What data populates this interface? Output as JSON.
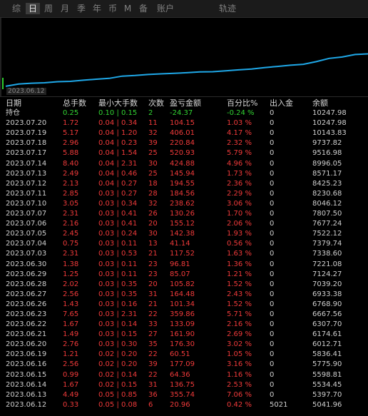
{
  "tabs": [
    "综",
    "日",
    "周",
    "月",
    "季",
    "年",
    "币",
    "M",
    "备",
    "账户",
    "轨迹"
  ],
  "active_tab": 1,
  "chart": {
    "date_label": "2023.06.12",
    "line_color": "#1fa8e8",
    "series": [
      5041.96,
      5397.7,
      5534.45,
      5598.81,
      5775.9,
      5836.41,
      6012.71,
      6174.61,
      6307.7,
      6667.56,
      6768.9,
      6933.38,
      7039.2,
      7124.27,
      7221.08,
      7338.6,
      7379.74,
      7522.12,
      7677.24,
      7807.5,
      8046.12,
      8230.68,
      8425.23,
      8571.17,
      8996.05,
      9516.98,
      9737.82,
      10143.83,
      10247.98
    ]
  },
  "colors": {
    "up": "#f03a3a",
    "down": "#32d232",
    "text": "#c8c8c8",
    "background": "#000000"
  },
  "table": {
    "headers": {
      "date": "日期",
      "total": "总手数",
      "minmax": "最小大手数",
      "count": "次数",
      "pl": "盈亏金额",
      "pct": "百分比%",
      "io": "出入金",
      "bal": "余额"
    },
    "holding": {
      "date": "持仓",
      "total": "0.25",
      "minmax": "0.10 | 0.15",
      "count": "2",
      "pl": "-24.37",
      "pct": "-0.24 %",
      "io": "0",
      "bal": "10247.98"
    },
    "rows": [
      {
        "date": "2023.07.20",
        "total": "1.72",
        "minmax": "0.04 | 0.34",
        "count": "11",
        "pl": "104.15",
        "pct": "1.03 %",
        "io": "0",
        "bal": "10247.98"
      },
      {
        "date": "2023.07.19",
        "total": "5.17",
        "minmax": "0.04 | 1.20",
        "count": "32",
        "pl": "406.01",
        "pct": "4.17 %",
        "io": "0",
        "bal": "10143.83"
      },
      {
        "date": "2023.07.18",
        "total": "2.96",
        "minmax": "0.04 | 0.23",
        "count": "39",
        "pl": "220.84",
        "pct": "2.32 %",
        "io": "0",
        "bal": "9737.82"
      },
      {
        "date": "2023.07.17",
        "total": "5.88",
        "minmax": "0.04 | 1.54",
        "count": "25",
        "pl": "520.93",
        "pct": "5.79 %",
        "io": "0",
        "bal": "9516.98"
      },
      {
        "date": "2023.07.14",
        "total": "8.40",
        "minmax": "0.04 | 2.31",
        "count": "30",
        "pl": "424.88",
        "pct": "4.96 %",
        "io": "0",
        "bal": "8996.05"
      },
      {
        "date": "2023.07.13",
        "total": "2.49",
        "minmax": "0.04 | 0.46",
        "count": "25",
        "pl": "145.94",
        "pct": "1.73 %",
        "io": "0",
        "bal": "8571.17"
      },
      {
        "date": "2023.07.12",
        "total": "2.13",
        "minmax": "0.04 | 0.27",
        "count": "18",
        "pl": "194.55",
        "pct": "2.36 %",
        "io": "0",
        "bal": "8425.23"
      },
      {
        "date": "2023.07.11",
        "total": "2.85",
        "minmax": "0.03 | 0.27",
        "count": "28",
        "pl": "184.56",
        "pct": "2.29 %",
        "io": "0",
        "bal": "8230.68"
      },
      {
        "date": "2023.07.10",
        "total": "3.05",
        "minmax": "0.03 | 0.34",
        "count": "32",
        "pl": "238.62",
        "pct": "3.06 %",
        "io": "0",
        "bal": "8046.12"
      },
      {
        "date": "2023.07.07",
        "total": "2.31",
        "minmax": "0.03 | 0.41",
        "count": "26",
        "pl": "130.26",
        "pct": "1.70 %",
        "io": "0",
        "bal": "7807.50"
      },
      {
        "date": "2023.07.06",
        "total": "2.16",
        "minmax": "0.03 | 0.41",
        "count": "20",
        "pl": "155.12",
        "pct": "2.06 %",
        "io": "0",
        "bal": "7677.24"
      },
      {
        "date": "2023.07.05",
        "total": "2.45",
        "minmax": "0.03 | 0.24",
        "count": "30",
        "pl": "142.38",
        "pct": "1.93 %",
        "io": "0",
        "bal": "7522.12"
      },
      {
        "date": "2023.07.04",
        "total": "0.75",
        "minmax": "0.03 | 0.11",
        "count": "13",
        "pl": "41.14",
        "pct": "0.56 %",
        "io": "0",
        "bal": "7379.74"
      },
      {
        "date": "2023.07.03",
        "total": "2.31",
        "minmax": "0.03 | 0.53",
        "count": "21",
        "pl": "117.52",
        "pct": "1.63 %",
        "io": "0",
        "bal": "7338.60"
      },
      {
        "date": "2023.06.30",
        "total": "1.38",
        "minmax": "0.03 | 0.11",
        "count": "23",
        "pl": "96.81",
        "pct": "1.36 %",
        "io": "0",
        "bal": "7221.08"
      },
      {
        "date": "2023.06.29",
        "total": "1.25",
        "minmax": "0.03 | 0.11",
        "count": "23",
        "pl": "85.07",
        "pct": "1.21 %",
        "io": "0",
        "bal": "7124.27"
      },
      {
        "date": "2023.06.28",
        "total": "2.02",
        "minmax": "0.03 | 0.35",
        "count": "20",
        "pl": "105.82",
        "pct": "1.52 %",
        "io": "0",
        "bal": "7039.20"
      },
      {
        "date": "2023.06.27",
        "total": "2.56",
        "minmax": "0.03 | 0.35",
        "count": "31",
        "pl": "164.48",
        "pct": "2.43 %",
        "io": "0",
        "bal": "6933.38"
      },
      {
        "date": "2023.06.26",
        "total": "1.43",
        "minmax": "0.03 | 0.16",
        "count": "21",
        "pl": "101.34",
        "pct": "1.52 %",
        "io": "0",
        "bal": "6768.90"
      },
      {
        "date": "2023.06.23",
        "total": "7.65",
        "minmax": "0.03 | 2.31",
        "count": "22",
        "pl": "359.86",
        "pct": "5.71 %",
        "io": "0",
        "bal": "6667.56"
      },
      {
        "date": "2023.06.22",
        "total": "1.67",
        "minmax": "0.03 | 0.14",
        "count": "33",
        "pl": "133.09",
        "pct": "2.16 %",
        "io": "0",
        "bal": "6307.70"
      },
      {
        "date": "2023.06.21",
        "total": "1.49",
        "minmax": "0.03 | 0.15",
        "count": "27",
        "pl": "161.90",
        "pct": "2.69 %",
        "io": "0",
        "bal": "6174.61"
      },
      {
        "date": "2023.06.20",
        "total": "2.76",
        "minmax": "0.03 | 0.30",
        "count": "35",
        "pl": "176.30",
        "pct": "3.02 %",
        "io": "0",
        "bal": "6012.71"
      },
      {
        "date": "2023.06.19",
        "total": "1.21",
        "minmax": "0.02 | 0.20",
        "count": "22",
        "pl": "60.51",
        "pct": "1.05 %",
        "io": "0",
        "bal": "5836.41"
      },
      {
        "date": "2023.06.16",
        "total": "2.56",
        "minmax": "0.02 | 0.20",
        "count": "39",
        "pl": "177.09",
        "pct": "3.16 %",
        "io": "0",
        "bal": "5775.90"
      },
      {
        "date": "2023.06.15",
        "total": "0.99",
        "minmax": "0.02 | 0.14",
        "count": "22",
        "pl": "64.36",
        "pct": "1.16 %",
        "io": "0",
        "bal": "5598.81"
      },
      {
        "date": "2023.06.14",
        "total": "1.67",
        "minmax": "0.02 | 0.15",
        "count": "31",
        "pl": "136.75",
        "pct": "2.53 %",
        "io": "0",
        "bal": "5534.45"
      },
      {
        "date": "2023.06.13",
        "total": "4.49",
        "minmax": "0.05 | 0.85",
        "count": "36",
        "pl": "355.74",
        "pct": "7.06 %",
        "io": "0",
        "bal": "5397.70"
      },
      {
        "date": "2023.06.12",
        "total": "0.33",
        "minmax": "0.05 | 0.08",
        "count": "6",
        "pl": "20.96",
        "pct": "0.42 %",
        "io": "5021",
        "bal": "5041.96"
      }
    ]
  }
}
